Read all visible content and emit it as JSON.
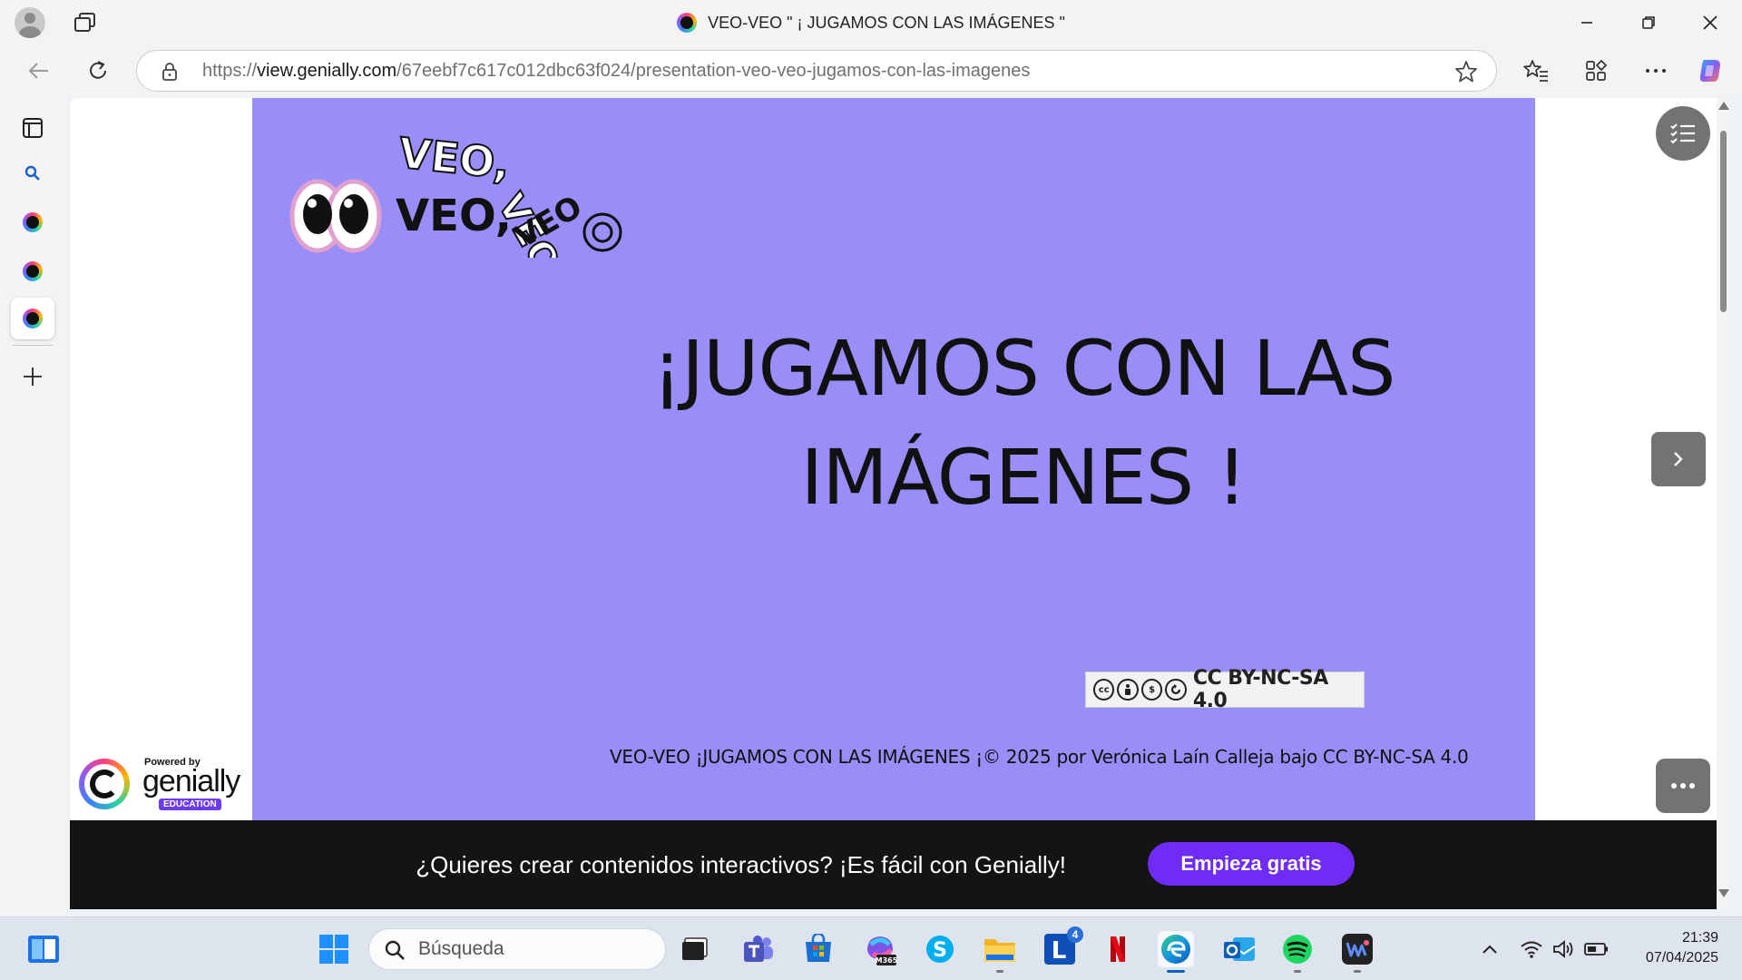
{
  "browser": {
    "tab_title": "VEO-VEO \" ¡ JUGAMOS CON LAS IMÁGENES \"",
    "url_prefix": "https://",
    "url_host": "view.genially.com",
    "url_path": "/67eebf7c617c012dbc63f024/presentation-veo-veo-jugamos-con-las-imagenes",
    "sidebar_tabs": [
      "genially-favicon",
      "genially-favicon",
      "genially-favicon"
    ]
  },
  "slide": {
    "logo_text": "VEO, VEO, VEO, VEO",
    "title": "¡JUGAMOS CON LAS IMÁGENES !",
    "license_label": "CC BY-NC-SA 4.0",
    "credit": "VEO-VEO ¡JUGAMOS CON LAS IMÁGENES ¡© 2025 por Verónica Laín Calleja bajo CC BY-NC-SA 4.0",
    "background": "#998df7"
  },
  "powered_by": {
    "small": "Powered by",
    "brand": "genially",
    "edition": "EDUCATION"
  },
  "banner": {
    "text": "¿Quieres crear contenidos interactivos? ¡Es fácil con Genially!",
    "cta": "Empieza gratis",
    "cta_color": "#6e2cf4"
  },
  "taskbar": {
    "search_placeholder": "Búsqueda",
    "lexi_badge": "4",
    "m365_label": "M365",
    "time": "21:39",
    "date": "07/04/2025"
  }
}
